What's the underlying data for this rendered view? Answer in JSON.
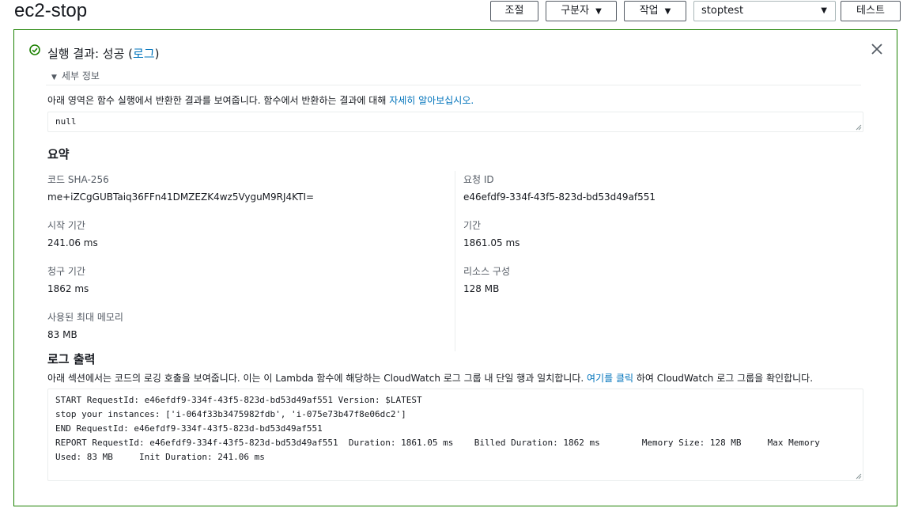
{
  "header": {
    "title": "ec2-stop",
    "buttons": {
      "adjust": "조절",
      "separator": "구분자",
      "actions": "작업",
      "test": "테스트"
    },
    "test_event_select": "stoptest"
  },
  "result": {
    "status_title": "실행 결과: 성공 (",
    "log_link": "로그",
    "status_title_end": ")",
    "details_label": "세부 정보",
    "intro_text": "아래 영역은 함수 실행에서 반환한 결과를 보여줍니다. 함수에서 반환하는 결과에 대해 ",
    "learn_more_link": "자세히 알아보십시오.",
    "return_value": "null",
    "status_color": "#1d8102"
  },
  "summary": {
    "heading": "요약",
    "left": [
      {
        "label": "코드 SHA-256",
        "value": "me+iZCgGUBTaiq36FFn41DMZEZK4wz5VyguM9RJ4KTI="
      },
      {
        "label": "시작 기간",
        "value": "241.06 ms"
      },
      {
        "label": "청구 기간",
        "value": "1862 ms"
      },
      {
        "label": "사용된 최대 메모리",
        "value": "83 MB"
      }
    ],
    "right": [
      {
        "label": "요청 ID",
        "value": "e46efdf9-334f-43f5-823d-bd53d49af551"
      },
      {
        "label": "기간",
        "value": "1861.05 ms"
      },
      {
        "label": "리소스 구성",
        "value": "128 MB"
      }
    ]
  },
  "log_output": {
    "heading": "로그 출력",
    "desc_start": "아래 섹션에서는 코드의 로깅 호출을 보여줍니다. 이는 이 Lambda 함수에 해당하는 CloudWatch 로그 그룹 내 단일 행과 일치합니다. ",
    "click_here_link": "여기를 클릭",
    "desc_end": " 하여 CloudWatch 로그 그룹을 확인합니다.",
    "text": "START RequestId: e46efdf9-334f-43f5-823d-bd53d49af551 Version: $LATEST\nstop your instances: ['i-064f33b3475982fdb', 'i-075e73b47f8e06dc2']\nEND RequestId: e46efdf9-334f-43f5-823d-bd53d49af551\nREPORT RequestId: e46efdf9-334f-43f5-823d-bd53d49af551  Duration: 1861.05 ms    Billed Duration: 1862 ms        Memory Size: 128 MB     Max Memory\nUsed: 83 MB     Init Duration: 241.06 ms"
  },
  "colors": {
    "link": "#0073bb",
    "text": "#16191f",
    "muted": "#545b64",
    "divider": "#eaeded"
  }
}
